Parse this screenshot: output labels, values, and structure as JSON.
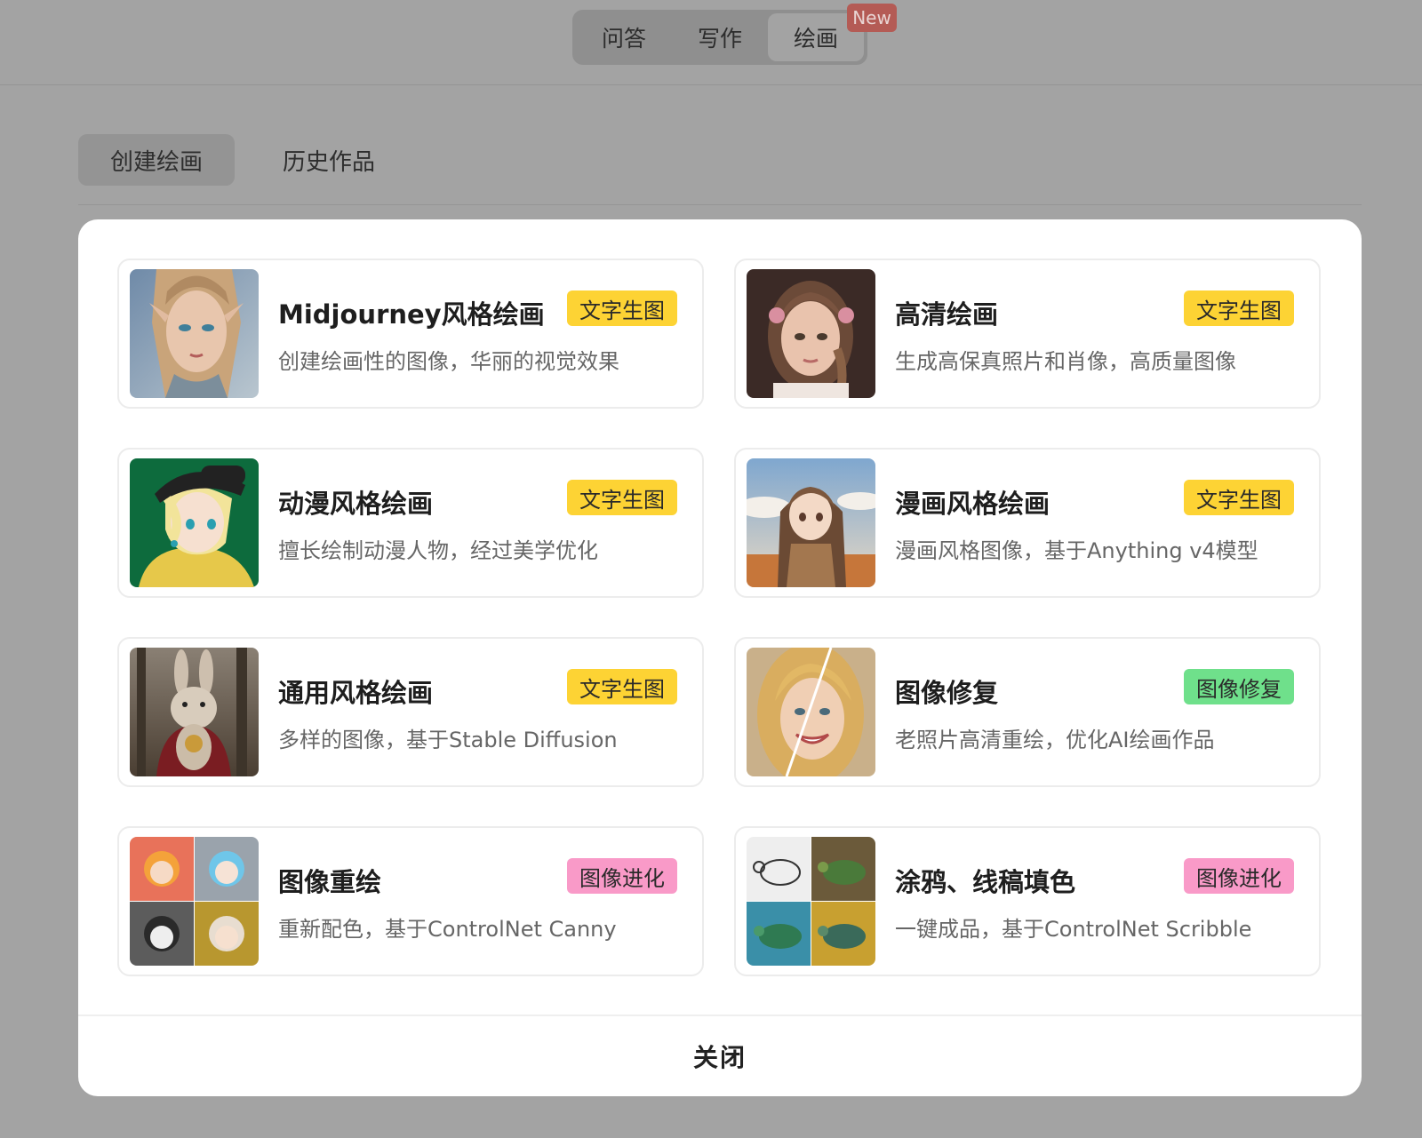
{
  "header": {
    "mode_tabs": [
      {
        "label": "问答"
      },
      {
        "label": "写作"
      },
      {
        "label": "绘画"
      }
    ],
    "new_badge": "New"
  },
  "subtabs": [
    {
      "label": "创建绘画"
    },
    {
      "label": "历史作品"
    }
  ],
  "modal": {
    "cards": [
      {
        "title": "Midjourney风格绘画",
        "desc": "创建绘画性的图像，华丽的视觉效果",
        "tag": "文字生图",
        "tag_color": "#fdd334",
        "thumb": "elf-portrait-image"
      },
      {
        "title": "高清绘画",
        "desc": "生成高保真照片和肖像，高质量图像",
        "tag": "文字生图",
        "tag_color": "#fdd334",
        "thumb": "girl-portrait-image"
      },
      {
        "title": "动漫风格绘画",
        "desc": "擅长绘制动漫人物，经过美学优化",
        "tag": "文字生图",
        "tag_color": "#fdd334",
        "thumb": "anime-character-image"
      },
      {
        "title": "漫画风格绘画",
        "desc": "漫画风格图像，基于Anything v4模型",
        "tag": "文字生图",
        "tag_color": "#fdd334",
        "thumb": "manga-girl-image"
      },
      {
        "title": "通用风格绘画",
        "desc": "多样的图像，基于Stable Diffusion",
        "tag": "文字生图",
        "tag_color": "#fdd334",
        "thumb": "rabbit-image"
      },
      {
        "title": "图像修复",
        "desc": "老照片高清重绘，优化AI绘画作品",
        "tag": "图像修复",
        "tag_color": "#6fe08b",
        "thumb": "restored-face-image"
      },
      {
        "title": "图像重绘",
        "desc": "重新配色，基于ControlNet Canny",
        "tag": "图像进化",
        "tag_color": "#f99ac8",
        "thumb": "chibi-grid-image"
      },
      {
        "title": "涂鸦、线稿填色",
        "desc": "一键成品，基于ControlNet Scribble",
        "tag": "图像进化",
        "tag_color": "#f99ac8",
        "thumb": "turtle-grid-image"
      }
    ],
    "close_label": "关闭"
  }
}
